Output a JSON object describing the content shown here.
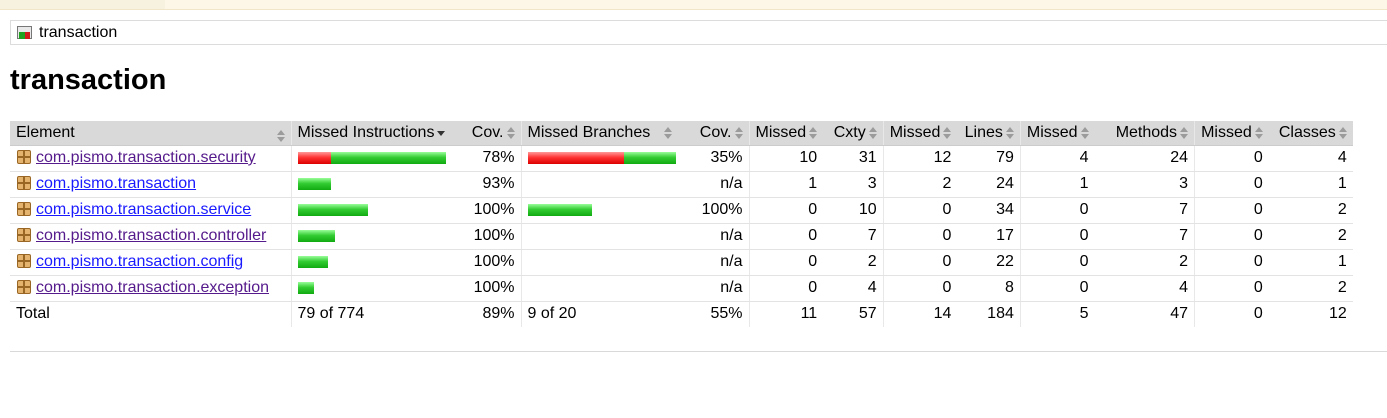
{
  "breadcrumb": {
    "label": "transaction",
    "icon": "report-icon"
  },
  "page": {
    "title": "transaction"
  },
  "table": {
    "headers": [
      "Element",
      "Missed Instructions",
      "Cov.",
      "Missed Branches",
      "Cov.",
      "Missed",
      "Cxty",
      "Missed",
      "Lines",
      "Missed",
      "Methods",
      "Missed",
      "Classes"
    ],
    "rows": [
      {
        "name": "com.pismo.transaction.security",
        "visited": true,
        "instr_cov_fraction": 0.78,
        "instr_cov": "78%",
        "branch_cov_fraction": 0.35,
        "branch_cov": "35%",
        "missed_cxty": "10",
        "cxty": "31",
        "missed_lines": "12",
        "lines": "79",
        "missed_methods": "4",
        "methods": "24",
        "missed_classes": "0",
        "classes": "4",
        "instr_total_rel": 1.0,
        "branch_total_rel": 1.0
      },
      {
        "name": "com.pismo.transaction",
        "visited": false,
        "instr_cov_fraction": 1.0,
        "instr_cov": "93%",
        "branch_cov_fraction": null,
        "branch_cov": "n/a",
        "missed_cxty": "1",
        "cxty": "3",
        "missed_lines": "2",
        "lines": "24",
        "missed_methods": "1",
        "methods": "3",
        "missed_classes": "0",
        "classes": "1",
        "instr_total_rel": 0.22,
        "branch_total_rel": 0
      },
      {
        "name": "com.pismo.transaction.service",
        "visited": false,
        "instr_cov_fraction": 1.0,
        "instr_cov": "100%",
        "branch_cov_fraction": 1.0,
        "branch_cov": "100%",
        "missed_cxty": "0",
        "cxty": "10",
        "missed_lines": "0",
        "lines": "34",
        "missed_methods": "0",
        "methods": "7",
        "missed_classes": "0",
        "classes": "2",
        "instr_total_rel": 0.47,
        "branch_total_rel": 0.43
      },
      {
        "name": "com.pismo.transaction.controller",
        "visited": true,
        "instr_cov_fraction": 1.0,
        "instr_cov": "100%",
        "branch_cov_fraction": null,
        "branch_cov": "n/a",
        "missed_cxty": "0",
        "cxty": "7",
        "missed_lines": "0",
        "lines": "17",
        "missed_methods": "0",
        "methods": "7",
        "missed_classes": "0",
        "classes": "2",
        "instr_total_rel": 0.25,
        "branch_total_rel": 0
      },
      {
        "name": "com.pismo.transaction.config",
        "visited": false,
        "instr_cov_fraction": 1.0,
        "instr_cov": "100%",
        "branch_cov_fraction": null,
        "branch_cov": "n/a",
        "missed_cxty": "0",
        "cxty": "2",
        "missed_lines": "0",
        "lines": "22",
        "missed_methods": "0",
        "methods": "2",
        "missed_classes": "0",
        "classes": "1",
        "instr_total_rel": 0.2,
        "branch_total_rel": 0
      },
      {
        "name": "com.pismo.transaction.exception",
        "visited": true,
        "instr_cov_fraction": 1.0,
        "instr_cov": "100%",
        "branch_cov_fraction": null,
        "branch_cov": "n/a",
        "missed_cxty": "0",
        "cxty": "4",
        "missed_lines": "0",
        "lines": "8",
        "missed_methods": "0",
        "methods": "4",
        "missed_classes": "0",
        "classes": "2",
        "instr_total_rel": 0.11,
        "branch_total_rel": 0
      }
    ],
    "total": {
      "label": "Total",
      "instr": "79 of 774",
      "instr_cov": "89%",
      "branch": "9 of 20",
      "branch_cov": "55%",
      "missed_cxty": "11",
      "cxty": "57",
      "missed_lines": "14",
      "lines": "184",
      "missed_methods": "5",
      "methods": "47",
      "missed_classes": "0",
      "classes": "12"
    }
  },
  "colors": {
    "covered": "#33cc33",
    "missed": "#ff3333",
    "link": "#1a1aff",
    "visited": "#551a8b",
    "header_bg": "#d9d9d9"
  }
}
